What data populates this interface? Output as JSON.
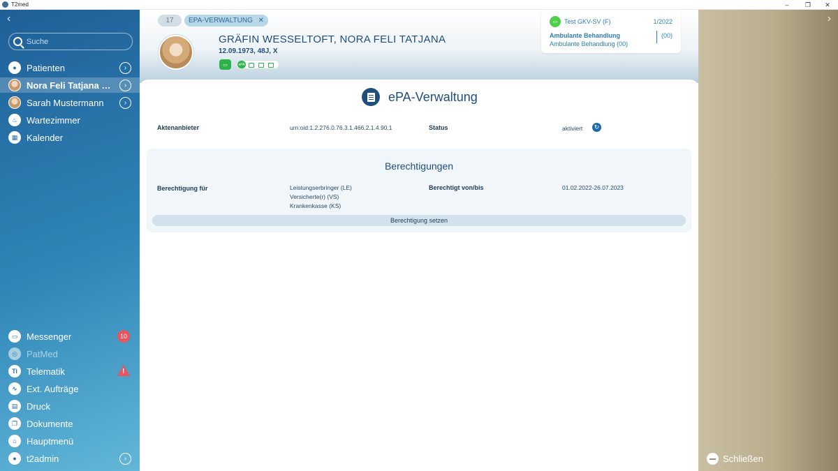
{
  "window": {
    "title": "T2med",
    "minimize": "–",
    "maximize": "❐",
    "close": "✕"
  },
  "sidebar": {
    "back": "‹",
    "search_placeholder": "Suche",
    "top_items": [
      {
        "label": "Patienten",
        "icon": "person-icon",
        "arrow": "›"
      },
      {
        "label": "Nora Feli Tatjana Wes...",
        "icon": "avatar",
        "arrow": "›",
        "selected": true
      },
      {
        "label": "Sarah Mustermann",
        "icon": "avatar",
        "arrow": "›"
      },
      {
        "label": "Wartezimmer",
        "icon": "waiting-room-icon"
      },
      {
        "label": "Kalender",
        "icon": "calendar-icon"
      }
    ],
    "bottom_items": [
      {
        "label": "Messenger",
        "icon": "chat-icon",
        "badge": "10"
      },
      {
        "label": "PatMed",
        "icon": "patmed-icon",
        "disabled": true
      },
      {
        "label": "Telematik",
        "icon": "ti-icon",
        "icon_text": "Ti",
        "warning": "!"
      },
      {
        "label": "Ext. Aufträge",
        "icon": "pulse-icon"
      },
      {
        "label": "Druck",
        "icon": "printer-icon"
      },
      {
        "label": "Dokumente",
        "icon": "documents-icon"
      },
      {
        "label": "Hauptmenü",
        "icon": "home-icon"
      },
      {
        "label": "t2admin",
        "icon": "person-icon",
        "arrow": "›"
      }
    ]
  },
  "header": {
    "tab_count": "17",
    "active_tab": "EPA-VERWALTUNG",
    "tab_close": "✕",
    "patient_name": "GRÄFIN WESSELTOFT,  NORA FELI TATJANA",
    "patient_info": "12.09.1973, 48J, X",
    "epa_chip": "ePA",
    "insurance": {
      "name": "Test GKV-SV (F)",
      "quarter": "1/2022",
      "treatment_title": "Ambulante Behandlung",
      "treatment_sub": "Ambulante Behandlung (00)",
      "count": "(00)"
    }
  },
  "main": {
    "title": "ePA-Verwaltung",
    "provider_label": "Aktenanbieter",
    "provider_value": "urn:oid:1.2.276.0.76.3.1.466.2.1.4.90.1",
    "status_label": "Status",
    "status_value": "aktiviert",
    "permissions": {
      "title": "Berechtigungen",
      "for_label": "Berechtigung für",
      "for_values": [
        "Leistungserbringer (LE)",
        "Versicherte(r) (VS)",
        "Krankenkasse (KS)"
      ],
      "period_label": "Berechtigt von/bis",
      "period_value": "01.02.2022-26.07.2023",
      "button": "Berechtigung setzen"
    }
  },
  "right_panel": {
    "forward": "›",
    "close_label": "Schließen"
  },
  "colors": {
    "sidebar_start": "#1f5f98",
    "sidebar_end": "#62b7d8",
    "accent_dark": "#1e4e7d",
    "accent_green": "#2bb34a",
    "badge_red": "#e9545e",
    "right_panel": "#b9ad8c"
  }
}
